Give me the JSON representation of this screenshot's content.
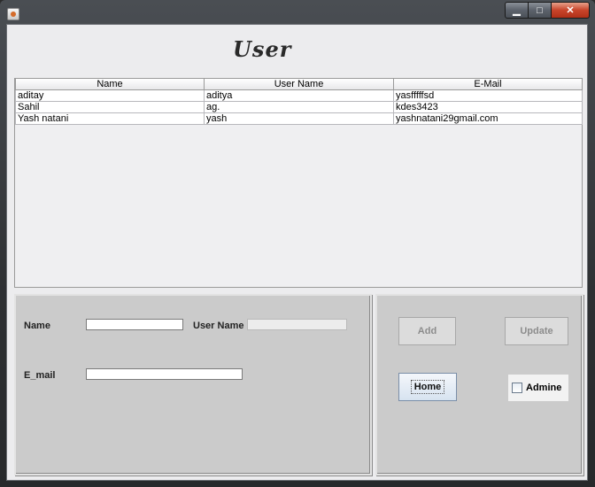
{
  "window": {
    "title": "",
    "app_icon": "java-icon",
    "controls": {
      "minimize": "▁",
      "maximize": "□",
      "close": "✕"
    }
  },
  "header": {
    "title": "User"
  },
  "table": {
    "columns": [
      "Name",
      "User Name",
      "E-Mail"
    ],
    "rows": [
      [
        "aditay",
        "aditya",
        "yasfffffsd"
      ],
      [
        "Sahil",
        "ag.",
        "kdes3423"
      ],
      [
        "Yash natani",
        "yash",
        "yashnatani29gmail.com"
      ]
    ]
  },
  "form": {
    "name_label": "Name",
    "name_value": "",
    "username_label": "User Name",
    "username_value": "",
    "email_label": "E_mail",
    "email_value": ""
  },
  "actions": {
    "add_label": "Add",
    "update_label": "Update",
    "home_label": "Home",
    "admin_label": "Admine",
    "admin_checked": false
  }
}
